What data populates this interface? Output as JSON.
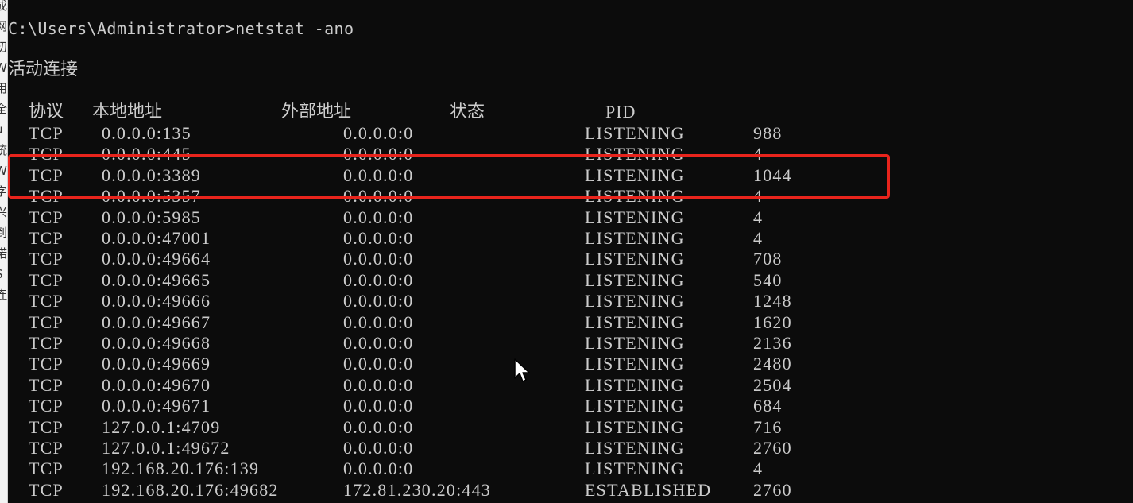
{
  "side_panel_glyphs": [
    "成",
    "网",
    "初",
    "W",
    "用",
    "全",
    "u",
    "统",
    "W",
    "字",
    "兴",
    "到",
    "诺",
    "S",
    "连"
  ],
  "console": {
    "prompt": "C:\\Users\\Administrator>netstat -ano",
    "heading": "活动连接",
    "columns": {
      "proto": "协议",
      "local": "本地地址",
      "foreign": "外部地址",
      "state": "状态",
      "pid": "PID"
    },
    "rows": [
      {
        "proto": "TCP",
        "local": "0.0.0.0:135",
        "foreign": "0.0.0.0:0",
        "state": "LISTENING",
        "pid": "988"
      },
      {
        "proto": "TCP",
        "local": "0.0.0.0:445",
        "foreign": "0.0.0.0:0",
        "state": "LISTENING",
        "pid": "4"
      },
      {
        "proto": "TCP",
        "local": "0.0.0.0:3389",
        "foreign": "0.0.0.0:0",
        "state": "LISTENING",
        "pid": "1044"
      },
      {
        "proto": "TCP",
        "local": "0.0.0.0:5357",
        "foreign": "0.0.0.0:0",
        "state": "LISTENING",
        "pid": "4"
      },
      {
        "proto": "TCP",
        "local": "0.0.0.0:5985",
        "foreign": "0.0.0.0:0",
        "state": "LISTENING",
        "pid": "4"
      },
      {
        "proto": "TCP",
        "local": "0.0.0.0:47001",
        "foreign": "0.0.0.0:0",
        "state": "LISTENING",
        "pid": "4"
      },
      {
        "proto": "TCP",
        "local": "0.0.0.0:49664",
        "foreign": "0.0.0.0:0",
        "state": "LISTENING",
        "pid": "708"
      },
      {
        "proto": "TCP",
        "local": "0.0.0.0:49665",
        "foreign": "0.0.0.0:0",
        "state": "LISTENING",
        "pid": "540"
      },
      {
        "proto": "TCP",
        "local": "0.0.0.0:49666",
        "foreign": "0.0.0.0:0",
        "state": "LISTENING",
        "pid": "1248"
      },
      {
        "proto": "TCP",
        "local": "0.0.0.0:49667",
        "foreign": "0.0.0.0:0",
        "state": "LISTENING",
        "pid": "1620"
      },
      {
        "proto": "TCP",
        "local": "0.0.0.0:49668",
        "foreign": "0.0.0.0:0",
        "state": "LISTENING",
        "pid": "2136"
      },
      {
        "proto": "TCP",
        "local": "0.0.0.0:49669",
        "foreign": "0.0.0.0:0",
        "state": "LISTENING",
        "pid": "2480"
      },
      {
        "proto": "TCP",
        "local": "0.0.0.0:49670",
        "foreign": "0.0.0.0:0",
        "state": "LISTENING",
        "pid": "2504"
      },
      {
        "proto": "TCP",
        "local": "0.0.0.0:49671",
        "foreign": "0.0.0.0:0",
        "state": "LISTENING",
        "pid": "684"
      },
      {
        "proto": "TCP",
        "local": "127.0.0.1:4709",
        "foreign": "0.0.0.0:0",
        "state": "LISTENING",
        "pid": "716"
      },
      {
        "proto": "TCP",
        "local": "127.0.0.1:49672",
        "foreign": "0.0.0.0:0",
        "state": "LISTENING",
        "pid": "2760"
      },
      {
        "proto": "TCP",
        "local": "192.168.20.176:139",
        "foreign": "0.0.0.0:0",
        "state": "LISTENING",
        "pid": "4"
      },
      {
        "proto": "TCP",
        "local": "192.168.20.176:49682",
        "foreign": "172.81.230.20:443",
        "state": "ESTABLISHED",
        "pid": "2760"
      }
    ]
  },
  "colors": {
    "background": "#0c0c0c",
    "text": "#cccccc",
    "highlight_border": "#e8241c"
  },
  "icons": {
    "cursor": "mouse-pointer-icon"
  }
}
